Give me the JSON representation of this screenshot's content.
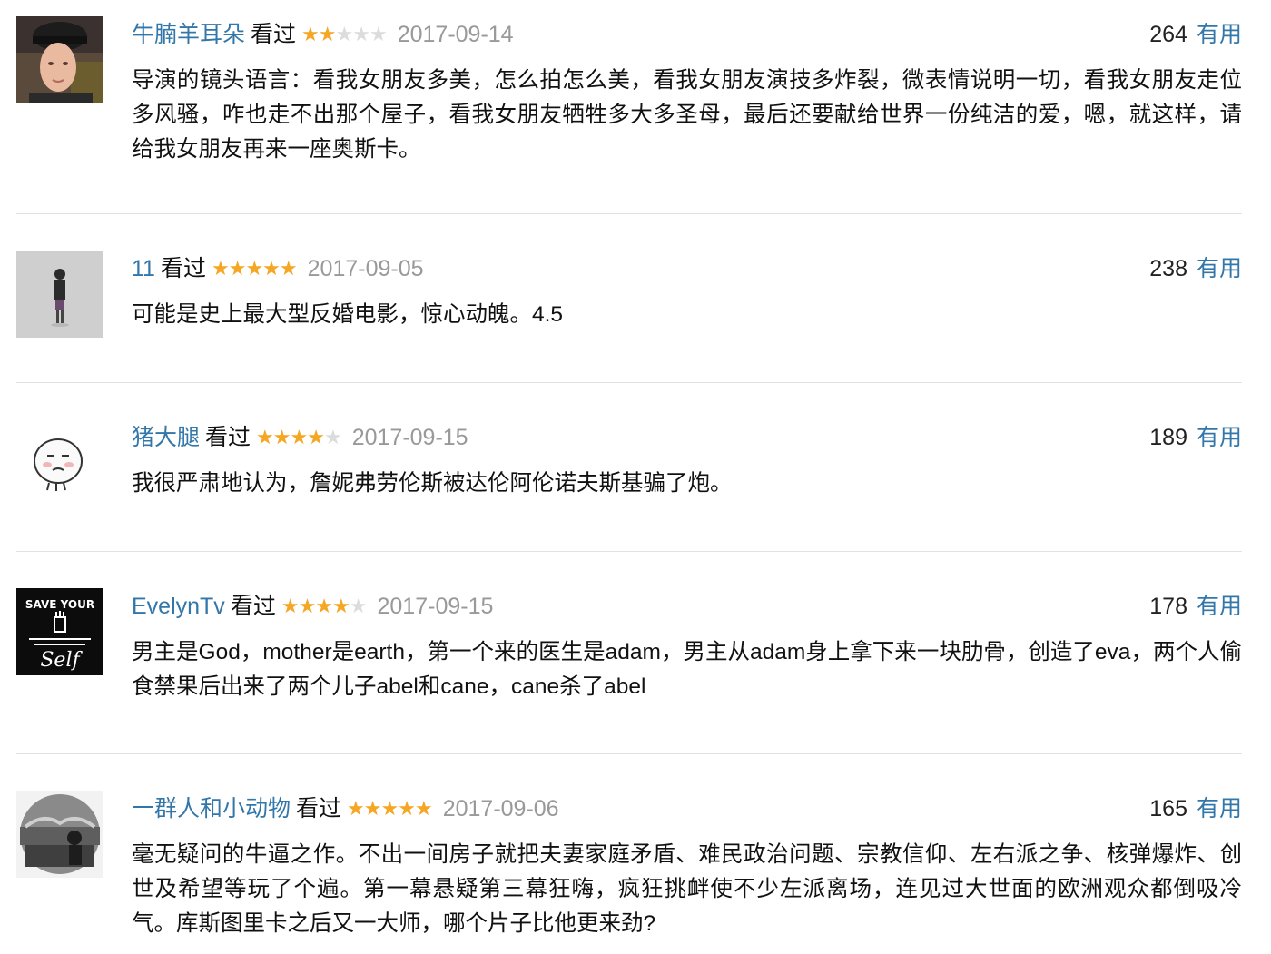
{
  "comments": [
    {
      "user": "牛腩羊耳朵",
      "status": "看过",
      "rating": 2,
      "date": "2017-09-14",
      "votes": "264",
      "useful_label": "有用",
      "text": "导演的镜头语言：看我女朋友多美，怎么拍怎么美，看我女朋友演技多炸裂，微表情说明一切，看我女朋友走位多风骚，咋也走不出那个屋子，看我女朋友牺牲多大多圣母，最后还要献给世界一份纯洁的爱，嗯，就这样，请给我女朋友再来一座奥斯卡。"
    },
    {
      "user": "11",
      "status": "看过",
      "rating": 5,
      "date": "2017-09-05",
      "votes": "238",
      "useful_label": "有用",
      "text": "可能是史上最大型反婚电影，惊心动魄。4.5"
    },
    {
      "user": "猪大腿",
      "status": "看过",
      "rating": 4,
      "date": "2017-09-15",
      "votes": "189",
      "useful_label": "有用",
      "text": "我很严肃地认为，詹妮弗劳伦斯被达伦阿伦诺夫斯基骗了炮。"
    },
    {
      "user": "EvelynTv",
      "status": "看过",
      "rating": 4,
      "date": "2017-09-15",
      "votes": "178",
      "useful_label": "有用",
      "text": "男主是God，mother是earth，第一个来的医生是adam，男主从adam身上拿下来一块肋骨，创造了eva，两个人偷食禁果后出来了两个儿子abel和cane，cane杀了abel",
      "avatar_text": [
        "SAVE YOUR",
        "Self"
      ]
    },
    {
      "user": "一群人和小动物",
      "status": "看过",
      "rating": 5,
      "date": "2017-09-06",
      "votes": "165",
      "useful_label": "有用",
      "text": "毫无疑问的牛逼之作。不出一间房子就把夫妻家庭矛盾、难民政治问题、宗教信仰、左右派之争、核弹爆炸、创世及希望等玩了个遍。第一幕悬疑第三幕狂嗨，疯狂挑衅使不少左派离场，连见过大世面的欧洲观众都倒吸冷气。库斯图里卡之后又一大师，哪个片子比他更来劲?"
    }
  ],
  "colors": {
    "link": "#3377aa",
    "star": "#f5a623",
    "star_empty": "#dcdcdc",
    "date": "#999999",
    "divider": "#e2e2e2"
  },
  "icons": {
    "star_filled": "★",
    "star_empty": "★"
  }
}
